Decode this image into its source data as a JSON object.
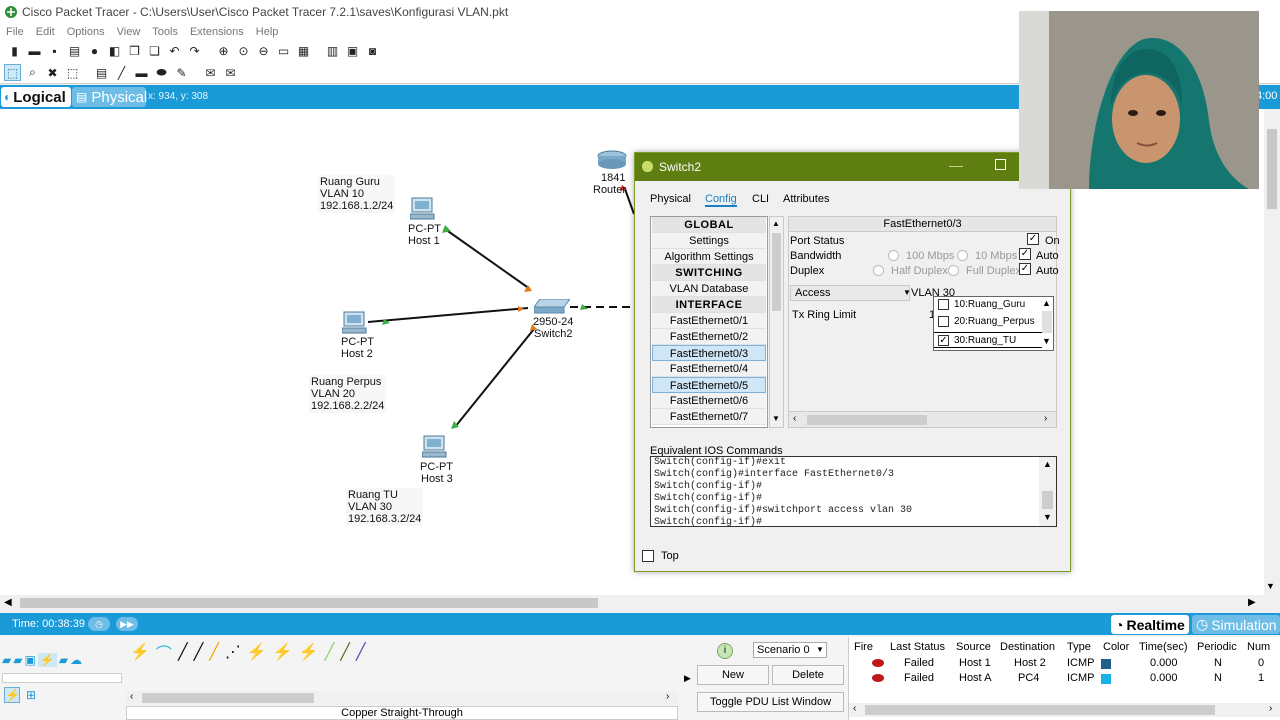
{
  "window": {
    "title": "Cisco Packet Tracer - C:\\Users\\User\\Cisco Packet Tracer 7.2.1\\saves\\Konfigurasi VLAN.pkt"
  },
  "menu": [
    "File",
    "Edit",
    "Options",
    "View",
    "Tools",
    "Extensions",
    "Help"
  ],
  "workspace": {
    "logical_label": "Logical",
    "physical_label": "Physical",
    "coords": "x: 934, y: 308",
    "right_time": "4:00"
  },
  "topology": {
    "router": {
      "model": "1841",
      "name": "Router"
    },
    "switch": {
      "model": "2950-24",
      "name": "Switch2"
    },
    "hosts": [
      {
        "type": "PC-PT",
        "name": "Host 1"
      },
      {
        "type": "PC-PT",
        "name": "Host 2"
      },
      {
        "type": "PC-PT",
        "name": "Host 3"
      }
    ],
    "notes": [
      {
        "room": "Ruang Guru",
        "vlan": "VLAN 10",
        "ip": "192.168.1.2/24"
      },
      {
        "room": "Ruang Perpus",
        "vlan": "VLAN 20",
        "ip": "192.168.2.2/24"
      },
      {
        "room": "Ruang TU",
        "vlan": "VLAN 30",
        "ip": "192.168.3.2/24"
      }
    ]
  },
  "dialog": {
    "title": "Switch2",
    "tabs": [
      "Physical",
      "Config",
      "CLI",
      "Attributes"
    ],
    "active_tab": "Config",
    "config_list": [
      {
        "label": "GLOBAL",
        "kind": "header"
      },
      {
        "label": "Settings",
        "kind": "item"
      },
      {
        "label": "Algorithm Settings",
        "kind": "item"
      },
      {
        "label": "SWITCHING",
        "kind": "header"
      },
      {
        "label": "VLAN Database",
        "kind": "item"
      },
      {
        "label": "INTERFACE",
        "kind": "header"
      },
      {
        "label": "FastEthernet0/1",
        "kind": "item"
      },
      {
        "label": "FastEthernet0/2",
        "kind": "item"
      },
      {
        "label": "FastEthernet0/3",
        "kind": "selected"
      },
      {
        "label": "FastEthernet0/4",
        "kind": "item"
      },
      {
        "label": "FastEthernet0/5",
        "kind": "selected"
      },
      {
        "label": "FastEthernet0/6",
        "kind": "item"
      },
      {
        "label": "FastEthernet0/7",
        "kind": "item"
      }
    ],
    "port": {
      "title": "FastEthernet0/3",
      "port_status_label": "Port Status",
      "port_status_value": "On",
      "bandwidth_label": "Bandwidth",
      "bandwidth_opt1": "100 Mbps",
      "bandwidth_opt2": "10 Mbps",
      "bandwidth_auto": "Auto",
      "duplex_label": "Duplex",
      "duplex_opt1": "Half Duplex",
      "duplex_opt2": "Full Duplex",
      "duplex_auto": "Auto",
      "mode": "Access",
      "vlan_value": "VLAN 30",
      "tx_ring_label": "Tx Ring Limit",
      "tx_ring_value": "1"
    },
    "vlan_options": [
      {
        "label": "10:Ruang_Guru",
        "checked": false
      },
      {
        "label": "20:Ruang_Perpus",
        "checked": false
      },
      {
        "label": "30:Ruang_TU",
        "checked": true
      }
    ],
    "ios_label": "Equivalent IOS Commands",
    "ios_lines": [
      "Switch(config-if)#exit",
      "Switch(config)#interface FastEthernet0/3",
      "Switch(config-if)#",
      "Switch(config-if)#",
      "Switch(config-if)#switchport access vlan 30",
      "Switch(config-if)#"
    ],
    "top_label": "Top"
  },
  "bottom": {
    "time_label": "Time: 00:38:39",
    "realtime_label": "Realtime",
    "simulation_label": "Simulation",
    "connection_label": "Copper Straight-Through",
    "scenario": "Scenario 0",
    "new_label": "New",
    "delete_label": "Delete",
    "toggle_label": "Toggle PDU List Window"
  },
  "events": {
    "headers": [
      "Fire",
      "Last Status",
      "Source",
      "Destination",
      "Type",
      "Color",
      "Time(sec)",
      "Periodic",
      "Num"
    ],
    "rows": [
      {
        "status": "Failed",
        "source": "Host 1",
        "destination": "Host 2",
        "type": "ICMP",
        "color": "#1f5f8a",
        "time": "0.000",
        "periodic": "N",
        "num": "0"
      },
      {
        "status": "Failed",
        "source": "Host A",
        "destination": "PC4",
        "type": "ICMP",
        "color": "#1ab1e6",
        "time": "0.000",
        "periodic": "N",
        "num": "1"
      }
    ]
  },
  "colors": {
    "accent_blue": "#1b9ad8",
    "dialog_title_green": "#5f7e12",
    "link_green": "#3cb043"
  }
}
